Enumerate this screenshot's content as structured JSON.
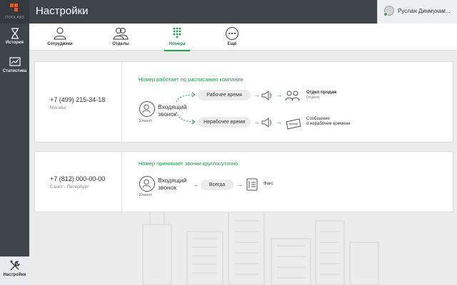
{
  "sidebar": {
    "logo_text": "ITOOLABS",
    "items": [
      {
        "label": "История",
        "icon": "hourglass-icon"
      },
      {
        "label": "Статистика",
        "icon": "chart-icon"
      },
      {
        "label": "Настройки",
        "icon": "tools-icon"
      }
    ]
  },
  "header": {
    "title": "Настройки",
    "user_name": "Руслан Динмухам..."
  },
  "tabs": [
    {
      "label": "Сотрудники",
      "icon": "user-icon"
    },
    {
      "label": "Отделы",
      "icon": "users-icon"
    },
    {
      "label": "Номера",
      "icon": "keypad-icon",
      "active": true
    },
    {
      "label": "Ещё",
      "icon": "more-icon"
    }
  ],
  "numbers": [
    {
      "phone": "+7 (499) 215-34-18",
      "city": "Москва",
      "schedule_text": "Номер работает по расписанию компании",
      "client_label": "Клиент",
      "incoming_label": "Входящий\nзвонок",
      "routes": [
        {
          "time_label": "Рабочее время",
          "dest_title": "Отдел продаж",
          "dest_sub": "(отдел)"
        },
        {
          "time_label": "Нерабочее время",
          "dest_line1": "Сообщение",
          "dest_line2": "о нерабочем времени"
        }
      ]
    },
    {
      "phone": "+7 (812) 000-00-00",
      "city": "Санкт - Петербург",
      "schedule_text": "Номер принимает звонки круглосуточно",
      "client_label": "Клиент",
      "incoming_label": "Входящий\nзвонок",
      "routes": [
        {
          "time_label": "Всегда",
          "dest_title": "Факс"
        }
      ]
    }
  ],
  "colors": {
    "accent": "#1e9b4c",
    "sidebar": "#3e4549",
    "logo": "#e25a2b"
  }
}
